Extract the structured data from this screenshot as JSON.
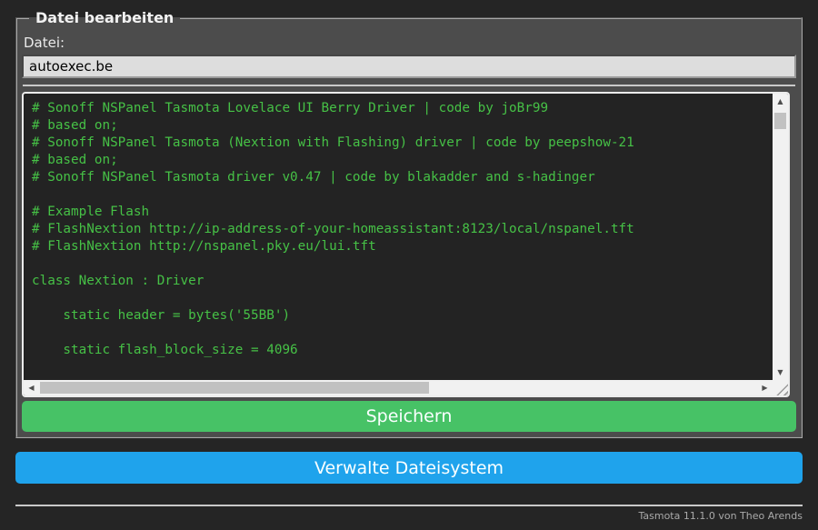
{
  "file_editor": {
    "legend": "Datei bearbeiten",
    "file_label": "Datei:",
    "filename_value": "autoexec.be",
    "content": "# Sonoff NSPanel Tasmota Lovelace UI Berry Driver | code by joBr99\n# based on;\n# Sonoff NSPanel Tasmota (Nextion with Flashing) driver | code by peepshow-21\n# based on;\n# Sonoff NSPanel Tasmota driver v0.47 | code by blakadder and s-hadinger\n\n# Example Flash\n# FlashNextion http://ip-address-of-your-homeassistant:8123/local/nspanel.tft\n# FlashNextion http://nspanel.pky.eu/lui.tft\n\nclass Nextion : Driver\n\n    static header = bytes('55BB')\n\n    static flash_block_size = 4096\n",
    "save_button_label": "Speichern"
  },
  "manage_fs_button_label": "Verwalte Dateisystem",
  "footer": {
    "text": "Tasmota 11.1.0 von Theo Arends"
  },
  "icons": {
    "scroll_up": "▲",
    "scroll_down": "▼",
    "scroll_left": "◀",
    "scroll_right": "▶"
  },
  "colors": {
    "page_background": "#252525",
    "panel_background": "#4c4c4c",
    "console_background": "#232323",
    "console_text": "#46c146",
    "save_button": "#47c266",
    "manage_button": "#1fa3ec",
    "button_text": "#faffff",
    "input_background": "#dddddd",
    "footer_text": "#aaaaaa"
  }
}
